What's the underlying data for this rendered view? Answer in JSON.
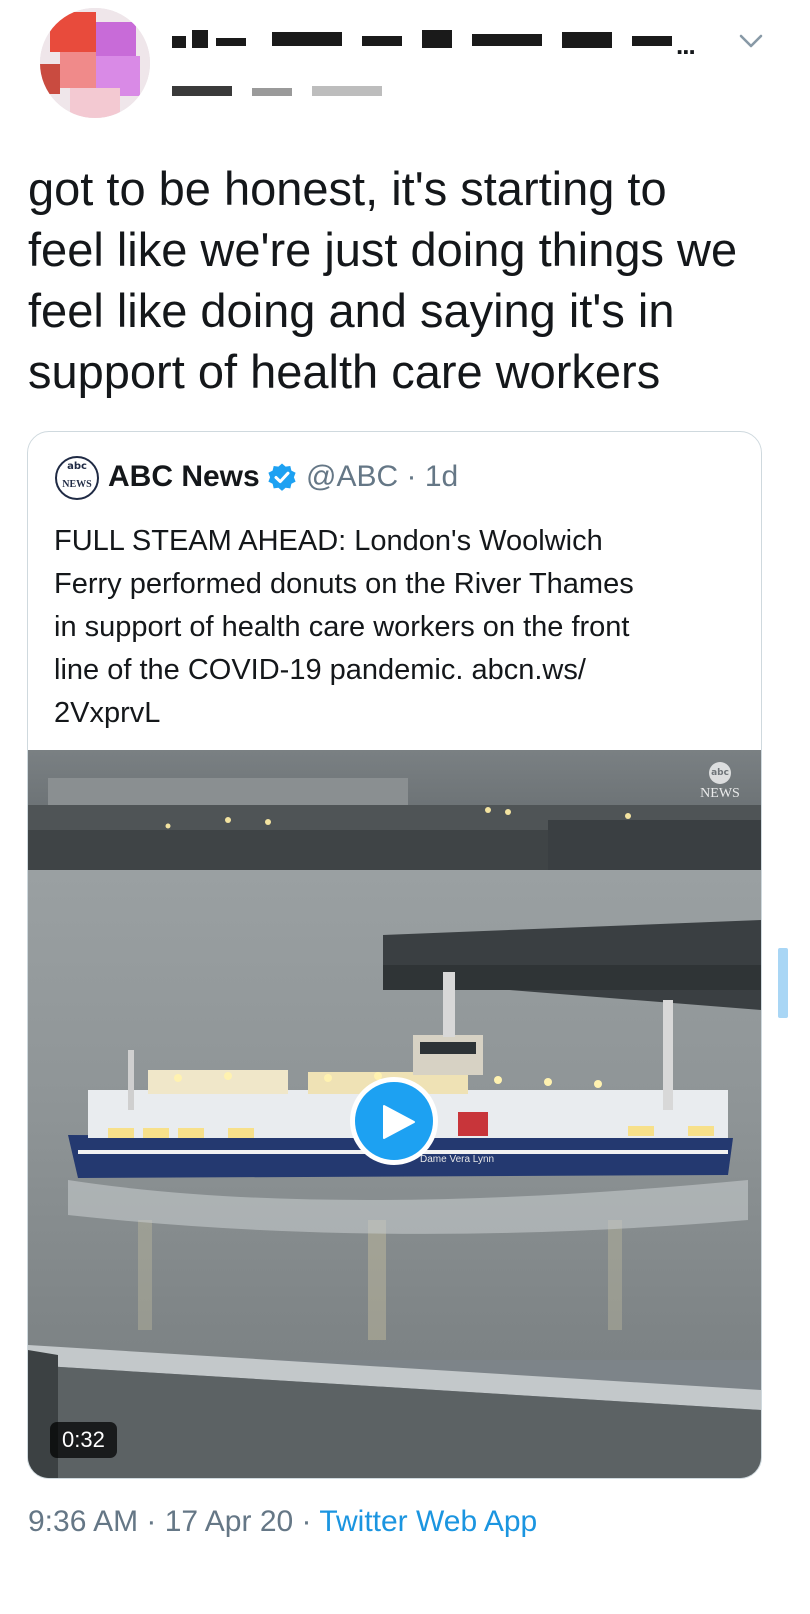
{
  "header": {
    "chevron_icon": "chevron-down-icon"
  },
  "tweet": {
    "text": "got to be honest, it's starting to\nfeel like we're just doing things we\nfeel like doing and saying it's in\nsupport of health care workers"
  },
  "quoted_tweet": {
    "logo_top": "abc",
    "logo_bottom": "NEWS",
    "author": "ABC News",
    "verified_icon": "verified-badge-icon",
    "handle": "@ABC",
    "separator": "·",
    "age": "1d",
    "text": "FULL STEAM AHEAD: London's Woolwich\nFerry performed donuts on the River Thames\nin support of health care workers on the front\nline of the COVID-19 pandemic. abcn.ws/\n2VxprvL",
    "video": {
      "watermark_top": "abc",
      "watermark_bottom": "NEWS",
      "play_icon": "play-icon",
      "duration": "0:32",
      "ferry_name": "Dame Vera Lynn"
    }
  },
  "footer": {
    "time": "9:36 AM",
    "sep1": " · ",
    "date": "17 Apr 20",
    "sep2": " · ",
    "source": "Twitter Web App"
  },
  "colors": {
    "text": "#14171a",
    "muted": "#657786",
    "link": "#1b95e0",
    "verified": "#1da1f2",
    "card_border": "#cfd9de"
  }
}
